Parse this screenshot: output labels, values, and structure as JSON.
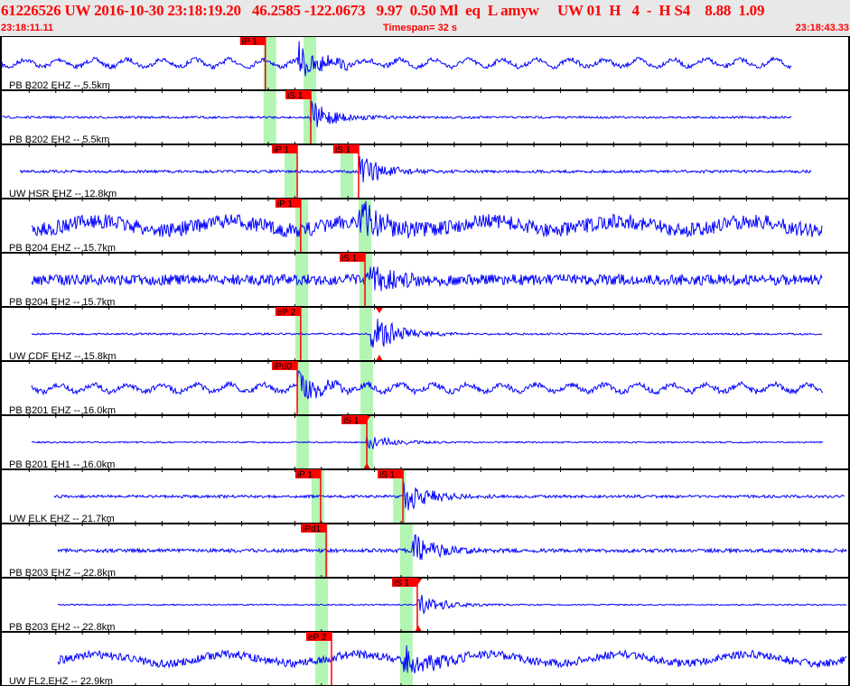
{
  "header": {
    "title": "61226526 UW 2016-10-30 23:18:19.20   46.2585 -122.0673   9.97  0.50 Ml  eq  L amyw     UW 01  H   4  -  H S4    8.88  1.09",
    "start_time": "23:18:11.11",
    "timespan": "Timespan=  32 s",
    "end_time": "23:18:43.33"
  },
  "timespan_s": 32,
  "colors": {
    "trace": "#0000ff",
    "pick": "#ff0000",
    "window": "#b3f5b3",
    "header_bg": "#e8e8e8"
  },
  "channels": [
    {
      "label": "PB B202 EHZ -- 5.5km",
      "picks": [
        {
          "label": "iP 1",
          "t": 9.99
        }
      ],
      "windows": [
        9.92,
        11.43
      ],
      "span": [
        0.07,
        29.82
      ],
      "onset": 11.2
    },
    {
      "label": "PB B202 EH2 -- 5.5km",
      "picks": [
        {
          "label": "iS 1",
          "t": 11.7
        }
      ],
      "windows": [
        9.92,
        11.43
      ],
      "span": [
        0.07,
        29.82
      ],
      "onset": 11.7
    },
    {
      "label": "UW HSR EHZ -- 12.8km",
      "picks": [
        {
          "label": "iP 1",
          "t": 11.19
        },
        {
          "label": "iS 1",
          "t": 13.5
        }
      ],
      "windows": [
        10.71,
        12.82
      ],
      "span": [
        0.75,
        30.54
      ],
      "onset": 13.5
    },
    {
      "label": "PB B204 EHZ -- 15.7km",
      "picks": [
        {
          "label": "iP 1",
          "t": 11.32
        }
      ],
      "windows": [
        11.12,
        13.5
      ],
      "span": [
        1.19,
        30.95
      ],
      "onset": 13.5
    },
    {
      "label": "PB B204 EH2 -- 15.7km",
      "picks": [
        {
          "label": "iS 1",
          "t": 13.74
        }
      ],
      "windows": [
        11.12,
        13.53
      ],
      "span": [
        1.19,
        30.95
      ],
      "onset": 13.7
    },
    {
      "label": "UW CDF EHZ -- 15.8km",
      "picks": [
        {
          "label": "eP 2",
          "t": 11.32
        }
      ],
      "windows": [
        11.12,
        13.53
      ],
      "span": [
        1.19,
        30.95
      ],
      "onset": 13.95,
      "marker": 14.28
    },
    {
      "label": "PB B201 EHZ -- 16.0km",
      "picks": [
        {
          "label": "iPd0",
          "t": 11.19
        }
      ],
      "windows": [
        11.16,
        13.57
      ],
      "span": [
        1.19,
        31.01
      ],
      "onset": 11.2
    },
    {
      "label": "PB B201 EH1 -- 16.0km",
      "picks": [
        {
          "label": "iS 1",
          "t": 13.81
        }
      ],
      "windows": [
        11.16,
        13.57
      ],
      "span": [
        1.19,
        31.01
      ],
      "onset": 13.8,
      "marker": 13.81
    },
    {
      "label": "UW ELK EHZ -- 21.7km",
      "picks": [
        {
          "label": "iP 1",
          "t": 12.07
        },
        {
          "label": "iS 1",
          "t": 15.17
        }
      ],
      "windows": [
        11.73,
        14.8
      ],
      "span": [
        2.04,
        31.8
      ],
      "onset": 15.2
    },
    {
      "label": "PB B203 EHZ -- 22.8km",
      "picks": [
        {
          "label": "iPd1",
          "t": 12.28
        }
      ],
      "windows": [
        11.87,
        15.06
      ],
      "span": [
        2.18,
        31.87
      ],
      "onset": 15.5
    },
    {
      "label": "PB B203 EH2 -- 22.8km",
      "picks": [
        {
          "label": "iS 1",
          "t": 15.71
        }
      ],
      "windows": [
        11.87,
        15.06
      ],
      "span": [
        2.18,
        31.87
      ],
      "onset": 15.7,
      "marker": 15.75
    },
    {
      "label": "UW FL2,EHZ -- 22.9km",
      "picks": [
        {
          "label": "eP 2",
          "t": 12.48
        }
      ],
      "windows": [
        11.87,
        15.06
      ],
      "span": [
        2.18,
        31.87
      ],
      "onset": 15.2
    }
  ]
}
